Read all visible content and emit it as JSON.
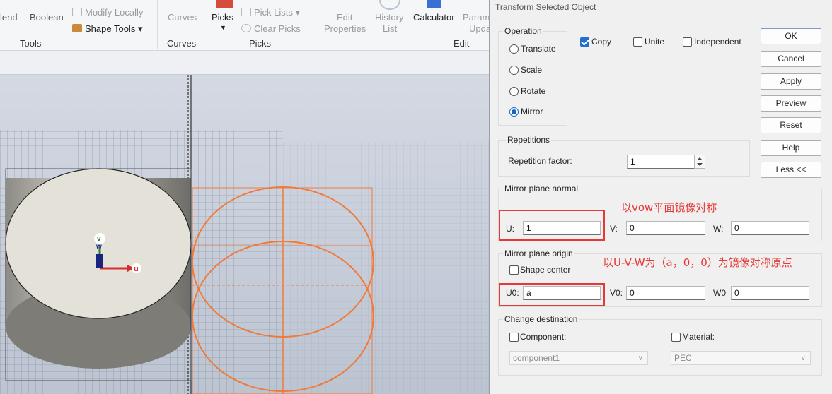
{
  "ribbon": {
    "blend_label": "lend",
    "boolean_label": "Boolean",
    "modify_locally_label": "Modify Locally",
    "shape_tools_label": "Shape Tools",
    "tools_group": "Tools",
    "curves_label": "Curves",
    "curves_group": "Curves",
    "picks_label": "Picks",
    "pick_lists_label": "Pick Lists",
    "clear_picks_label": "Clear Picks",
    "picks_group": "Picks",
    "edit_properties_line1": "Edit",
    "edit_properties_line2": "Properties",
    "history_list_line1": "History",
    "history_list_line2": "List",
    "calculator_label": "Calculator",
    "param_line1": "Param",
    "param_line2": "Upda",
    "edit_group": "Edit"
  },
  "viewport": {
    "axis_u": "u",
    "axis_v": "v",
    "axis_w": "w"
  },
  "dialog": {
    "title": "Transform Selected Object",
    "operation": {
      "legend": "Operation",
      "options": [
        {
          "label": "Translate",
          "selected": false
        },
        {
          "label": "Scale",
          "selected": false
        },
        {
          "label": "Rotate",
          "selected": false
        },
        {
          "label": "Mirror",
          "selected": true
        }
      ]
    },
    "checks": {
      "copy": {
        "label": "Copy",
        "checked": true
      },
      "unite": {
        "label": "Unite",
        "checked": false
      },
      "independent": {
        "label": "Independent",
        "checked": false
      }
    },
    "buttons": {
      "ok": "OK",
      "cancel": "Cancel",
      "apply": "Apply",
      "preview": "Preview",
      "reset": "Reset",
      "help": "Help",
      "less": "Less <<"
    },
    "repetitions": {
      "legend": "Repetitions",
      "factor_label": "Repetition factor:",
      "factor_value": "1"
    },
    "mirror_normal": {
      "legend": "Mirror plane normal",
      "u_label": "U:",
      "u_value": "1",
      "v_label": "V:",
      "v_value": "0",
      "w_label": "W:",
      "w_value": "0"
    },
    "mirror_origin": {
      "legend": "Mirror plane origin",
      "shape_center_label": "Shape center",
      "shape_center_checked": false,
      "u0_label": "U0:",
      "u0_value": "a",
      "v0_label": "V0:",
      "v0_value": "0",
      "w0_label": "W0",
      "w0_value": "0"
    },
    "destination": {
      "legend": "Change destination",
      "component_label": "Component:",
      "component_checked": false,
      "component_value": "component1",
      "material_label": "Material:",
      "material_checked": false,
      "material_value": "PEC"
    },
    "annotations": {
      "normal_note": "以vow平面镜像对称",
      "origin_note": "以U-V-W为（a，0，0）为镜像对称原点"
    }
  },
  "colors": {
    "highlight_red": "#e53935",
    "preview_orange": "#f07a3a",
    "accent_blue": "#1565c0"
  }
}
